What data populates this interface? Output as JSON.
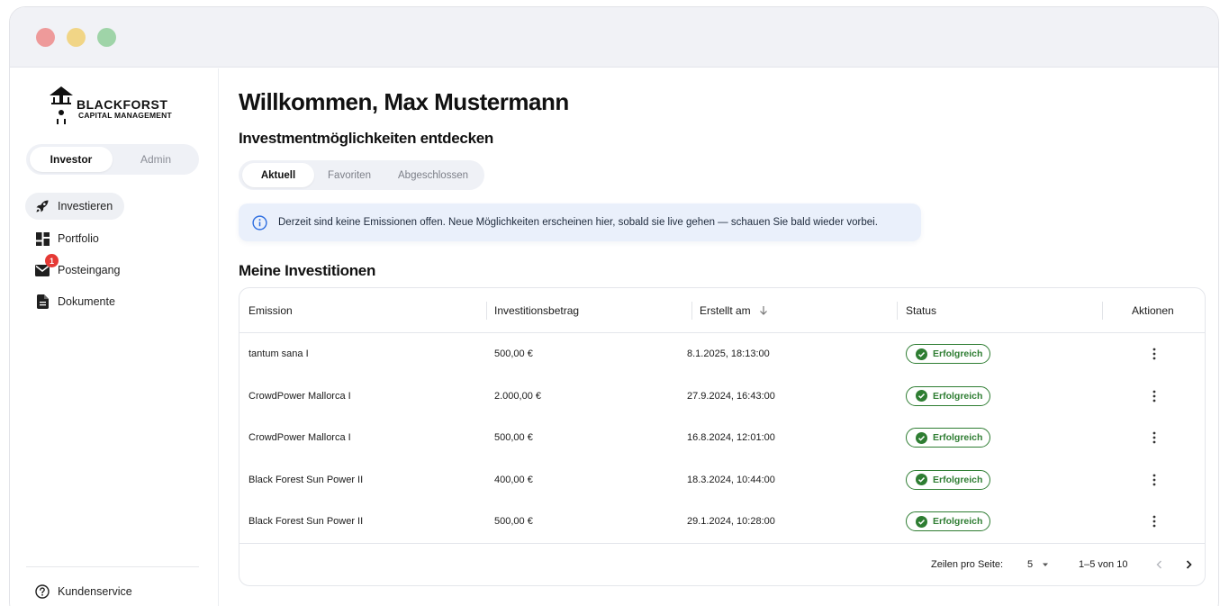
{
  "window": {
    "controls": [
      "close",
      "minimize",
      "maximize"
    ]
  },
  "brand": {
    "line1": "BLACKFORST",
    "line2": "CAPITAL MANAGEMENT"
  },
  "roles": {
    "active": "Investor",
    "inactive": "Admin"
  },
  "nav": {
    "items": [
      {
        "label": "Investieren",
        "icon": "rocket-icon",
        "active": true
      },
      {
        "label": "Portfolio",
        "icon": "dashboard-icon",
        "active": false
      },
      {
        "label": "Posteingang",
        "icon": "mail-icon",
        "active": false,
        "badge": "1"
      },
      {
        "label": "Dokumente",
        "icon": "document-icon",
        "active": false
      }
    ],
    "support": {
      "label": "Kundenservice",
      "icon": "help-icon"
    }
  },
  "main": {
    "welcome": "Willkommen, Max Mustermann",
    "subheading": "Investmentmöglichkeiten entdecken",
    "tabs": [
      "Aktuell",
      "Favoriten",
      "Abgeschlossen"
    ],
    "info": "Derzeit sind keine Emissionen offen. Neue Möglichkeiten erscheinen hier, sobald sie live gehen — schauen Sie bald wieder vorbei.",
    "section_title": "Meine Investitionen"
  },
  "table": {
    "columns": [
      "Emission",
      "Investitionsbetrag",
      "Erstellt am",
      "Status",
      "Aktionen"
    ],
    "sort_icon": "arrow-down-icon",
    "rows": [
      {
        "emission": "tantum sana I",
        "amount": "500,00 €",
        "created": "8.1.2025, 18:13:00",
        "status": "Erfolgreich"
      },
      {
        "emission": "CrowdPower Mallorca I",
        "amount": "2.000,00 €",
        "created": "27.9.2024, 16:43:00",
        "status": "Erfolgreich"
      },
      {
        "emission": "CrowdPower Mallorca I",
        "amount": "500,00 €",
        "created": "16.8.2024, 12:01:00",
        "status": "Erfolgreich"
      },
      {
        "emission": "Black Forest Sun Power II",
        "amount": "400,00 €",
        "created": "18.3.2024, 10:44:00",
        "status": "Erfolgreich"
      },
      {
        "emission": "Black Forest Sun Power II",
        "amount": "500,00 €",
        "created": "29.1.2024, 10:28:00",
        "status": "Erfolgreich"
      }
    ],
    "footer": {
      "rows_per_page_label": "Zeilen pro Seite:",
      "rows_per_page_value": "5",
      "range": "1–5 von 10"
    }
  },
  "colors": {
    "success": "#2e7d32",
    "badge": "#e53935",
    "info_bg": "#eaf0fb",
    "accent_blue": "#2f6fe0"
  }
}
